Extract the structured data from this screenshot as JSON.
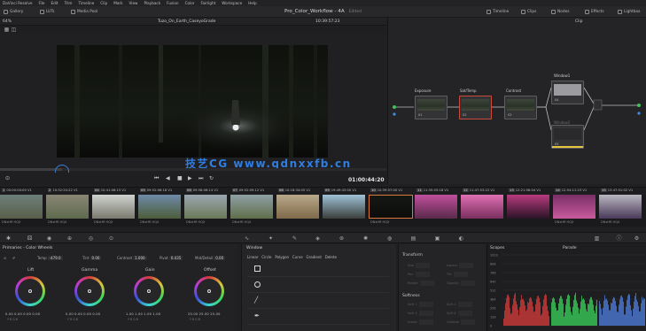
{
  "menu": [
    "DaVinci Resolve",
    "File",
    "Edit",
    "Trim",
    "Timeline",
    "Clip",
    "Mark",
    "View",
    "Playback",
    "Fusion",
    "Color",
    "Fairlight",
    "Workspace",
    "Help"
  ],
  "toolbar": {
    "left": [
      "Gallery",
      "LUTs",
      "Media Pool"
    ],
    "project_title": "Pro_Color_Workflow - 4A",
    "edited": "Edited",
    "right": [
      "Timeline",
      "Clips",
      "Nodes",
      "Effects",
      "Lightbox"
    ]
  },
  "viewer": {
    "zoom": "64%",
    "clip_name": "Tuzo_On_Earth_CaseyoGrade",
    "timecode_top": "10:39:57:23",
    "timecode_main": "01:00:44:20",
    "watermark": "技艺CG www.qdnxxfb.cn"
  },
  "nodes": {
    "mode": "Clip",
    "items": [
      {
        "label": "Exposure",
        "num": "01"
      },
      {
        "label": "Sat/Temp",
        "num": "02"
      },
      {
        "label": "Contrast",
        "num": "03"
      },
      {
        "label": "Window1",
        "num": "04"
      },
      {
        "label": "Window2",
        "num": "05"
      }
    ]
  },
  "clips": [
    {
      "n": "1",
      "tc": "00:00:00:00",
      "v": "V1",
      "codec": "DNxHR HQX"
    },
    {
      "n": "2",
      "tc": "10:32:20:22",
      "v": "V1",
      "codec": "DNxHR HQX"
    },
    {
      "n": "04",
      "tc": "10:41:06:15",
      "v": "V1",
      "codec": "DNxHR HQX"
    },
    {
      "n": "05",
      "tc": "09:52:06:18",
      "v": "V1",
      "codec": "DNxHR HQX"
    },
    {
      "n": "06",
      "tc": "09:58:06:14",
      "v": "V1",
      "codec": "DNxHR HQX"
    },
    {
      "n": "07",
      "tc": "09:52:09:12",
      "v": "V1",
      "codec": "DNxHR HQX"
    },
    {
      "n": "08",
      "tc": "10:18:34:05",
      "v": "V1",
      "codec": ""
    },
    {
      "n": "09",
      "tc": "19:49:43:00",
      "v": "V1",
      "codec": ""
    },
    {
      "n": "10",
      "tc": "10:39:57:00",
      "v": "V1",
      "codec": "DNxHR HQX"
    },
    {
      "n": "11",
      "tc": "11:35:53:18",
      "v": "V1",
      "codec": ""
    },
    {
      "n": "12",
      "tc": "11:47:53:22",
      "v": "V1",
      "codec": ""
    },
    {
      "n": "13",
      "tc": "12:21:58:04",
      "v": "V1",
      "codec": ""
    },
    {
      "n": "14",
      "tc": "12:54:11:23",
      "v": "V1",
      "codec": "DNxHR HQX"
    },
    {
      "n": "15",
      "tc": "13:47:51:02",
      "v": "V1",
      "codec": "DNxHR HQX"
    }
  ],
  "color_wheels": {
    "title": "Primaries - Color Wheels",
    "temp_label": "Temp",
    "temp": "-479.0",
    "tint_label": "Tint",
    "tint": "0.00",
    "contrast_label": "Contrast",
    "contrast": "1.000",
    "pivot_label": "Pivot",
    "pivot": "0.435",
    "middetail_label": "Mid/Detail",
    "middetail": "0.00",
    "wheels": [
      {
        "name": "Lift",
        "vals": "0.00   0.00   0.00   0.00"
      },
      {
        "name": "Gamma",
        "vals": "0.00   0.00   0.00   0.00"
      },
      {
        "name": "Gain",
        "vals": "1.00   1.00   1.00   1.00"
      },
      {
        "name": "Offset",
        "vals": "25.00  25.00  25.00"
      }
    ],
    "channels": "Y    R    G    B"
  },
  "window": {
    "title": "Window",
    "tools": [
      "Linear",
      "Circle",
      "Polygon",
      "Curve",
      "Gradient",
      "Delete"
    ]
  },
  "transform": {
    "title": "Transform",
    "rows": [
      "Size",
      "Pan",
      "Rotate",
      "Opacity"
    ],
    "rows2": [
      "Aspect",
      "Tilt",
      "Opacity",
      "Pan"
    ],
    "softness_title": "Softness",
    "soft_rows": [
      "Soft 1",
      "Soft 3",
      "Inside"
    ],
    "soft_rows2": [
      "Soft 2",
      "Soft 4",
      "Outside"
    ]
  },
  "scopes": {
    "title": "Scopes",
    "mode": "Parade",
    "levels": [
      "1023",
      "896",
      "768",
      "640",
      "512",
      "384",
      "256",
      "128",
      "0"
    ]
  }
}
